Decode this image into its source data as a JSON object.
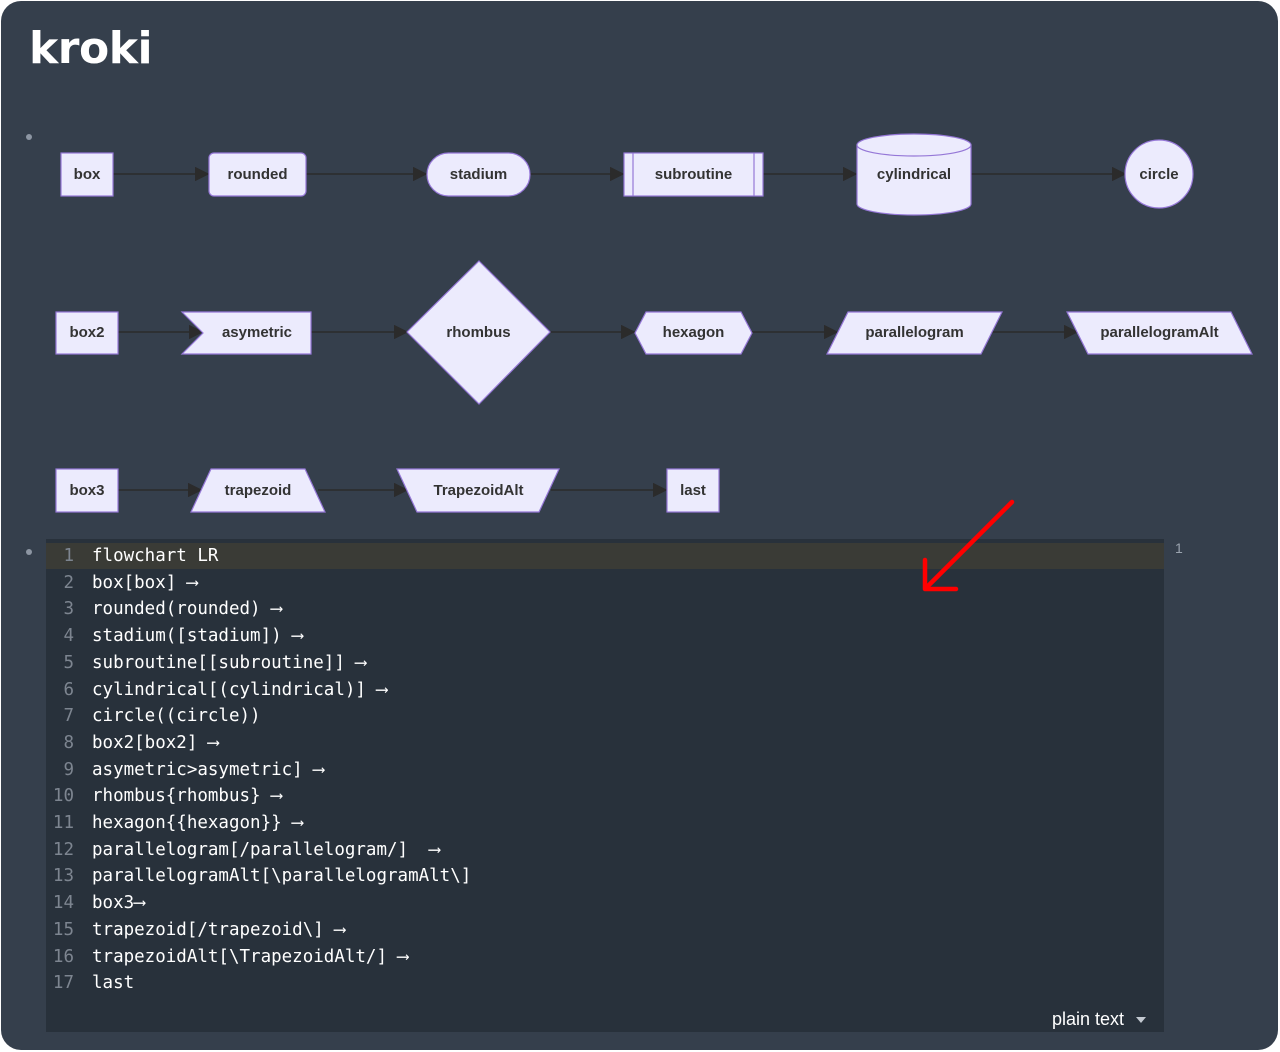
{
  "page": {
    "title": "kroki"
  },
  "diagram": {
    "nodes": {
      "box": "box",
      "rounded": "rounded",
      "stadium": "stadium",
      "subroutine": "subroutine",
      "cylindrical": "cylindrical",
      "circle": "circle",
      "box2": "box2",
      "asymetric": "asymetric",
      "rhombus": "rhombus",
      "hexagon": "hexagon",
      "parallelogram": "parallelogram",
      "parallelogramAlt": "parallelogramAlt",
      "box3": "box3",
      "trapezoid": "trapezoid",
      "trapezoidAlt": "TrapezoidAlt",
      "last": "last"
    },
    "colors": {
      "fill": "#ecebfd",
      "stroke": "#9577d7",
      "edge": "#2b2b2b"
    }
  },
  "code": {
    "lines": [
      "flowchart LR",
      "box[box] ⟶",
      "rounded(rounded) ⟶",
      "stadium([stadium]) ⟶",
      "subroutine[[subroutine]] ⟶",
      "cylindrical[(cylindrical)] ⟶",
      "circle((circle))",
      "box2[box2] ⟶",
      "asymetric>asymetric] ⟶",
      "rhombus{rhombus} ⟶",
      "hexagon{{hexagon}} ⟶",
      "parallelogram[/parallelogram/]  ⟶",
      "parallelogramAlt[\\parallelogramAlt\\]",
      "box3⟶",
      "trapezoid[/trapezoid\\] ⟶",
      "trapezoidAlt[\\TrapezoidAlt/] ⟶",
      "last"
    ],
    "language": "plain text",
    "block_count": "1"
  },
  "annotation": {
    "arrow_color": "#ff0000",
    "icon": "red-arrow-icon"
  }
}
